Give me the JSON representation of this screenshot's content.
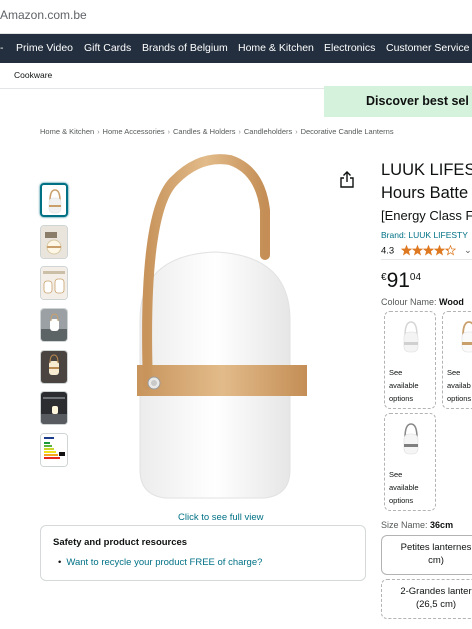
{
  "browser": {
    "url": "Amazon.com.be"
  },
  "nav": {
    "items": [
      "Prime Video",
      "Gift Cards",
      "Brands of Belgium",
      "Home & Kitchen",
      "Electronics",
      "Customer Service"
    ]
  },
  "subnav": {
    "item": "Cookware"
  },
  "promo": {
    "text": "Discover best sel"
  },
  "breadcrumb": [
    "Home & Kitchen",
    "Home Accessories",
    "Candles & Holders",
    "Candleholders",
    "Decorative Candle Lanterns"
  ],
  "gallery": {
    "full_view_link": "Click to see full view"
  },
  "safety": {
    "title": "Safety and product resources",
    "link": "Want to recycle your product FREE of charge?"
  },
  "product": {
    "title_line1": "LUUK LIFEST",
    "title_line2": "Hours Batte",
    "energy_class": "[Energy Class F",
    "brand": "Brand: LUUK LIFESTY",
    "rating": "4.3",
    "rating_value": 4.3,
    "rating_max": 5,
    "star_color": "#de7921",
    "price_symbol": "€",
    "price_whole": "91",
    "price_fraction": "04"
  },
  "colour": {
    "label": "Colour Name:",
    "selected": "Wood",
    "options": [
      {
        "line1": "See",
        "line2": "available",
        "line3": "options"
      },
      {
        "line1": "See",
        "line2": "availab",
        "line3": "options"
      },
      {
        "line1": "See",
        "line2": "available",
        "line3": "options"
      }
    ]
  },
  "size": {
    "label": "Size Name:",
    "selected": "36cm",
    "options": [
      {
        "line1": "Petites lanternes",
        "line2": "cm)"
      },
      {
        "line1": "2-Grandes lanter",
        "line2": "(26,5 cm)"
      }
    ]
  },
  "colors": {
    "nav_bg": "#232f3e",
    "link": "#007185",
    "promo_bg": "#d5f2dc"
  }
}
